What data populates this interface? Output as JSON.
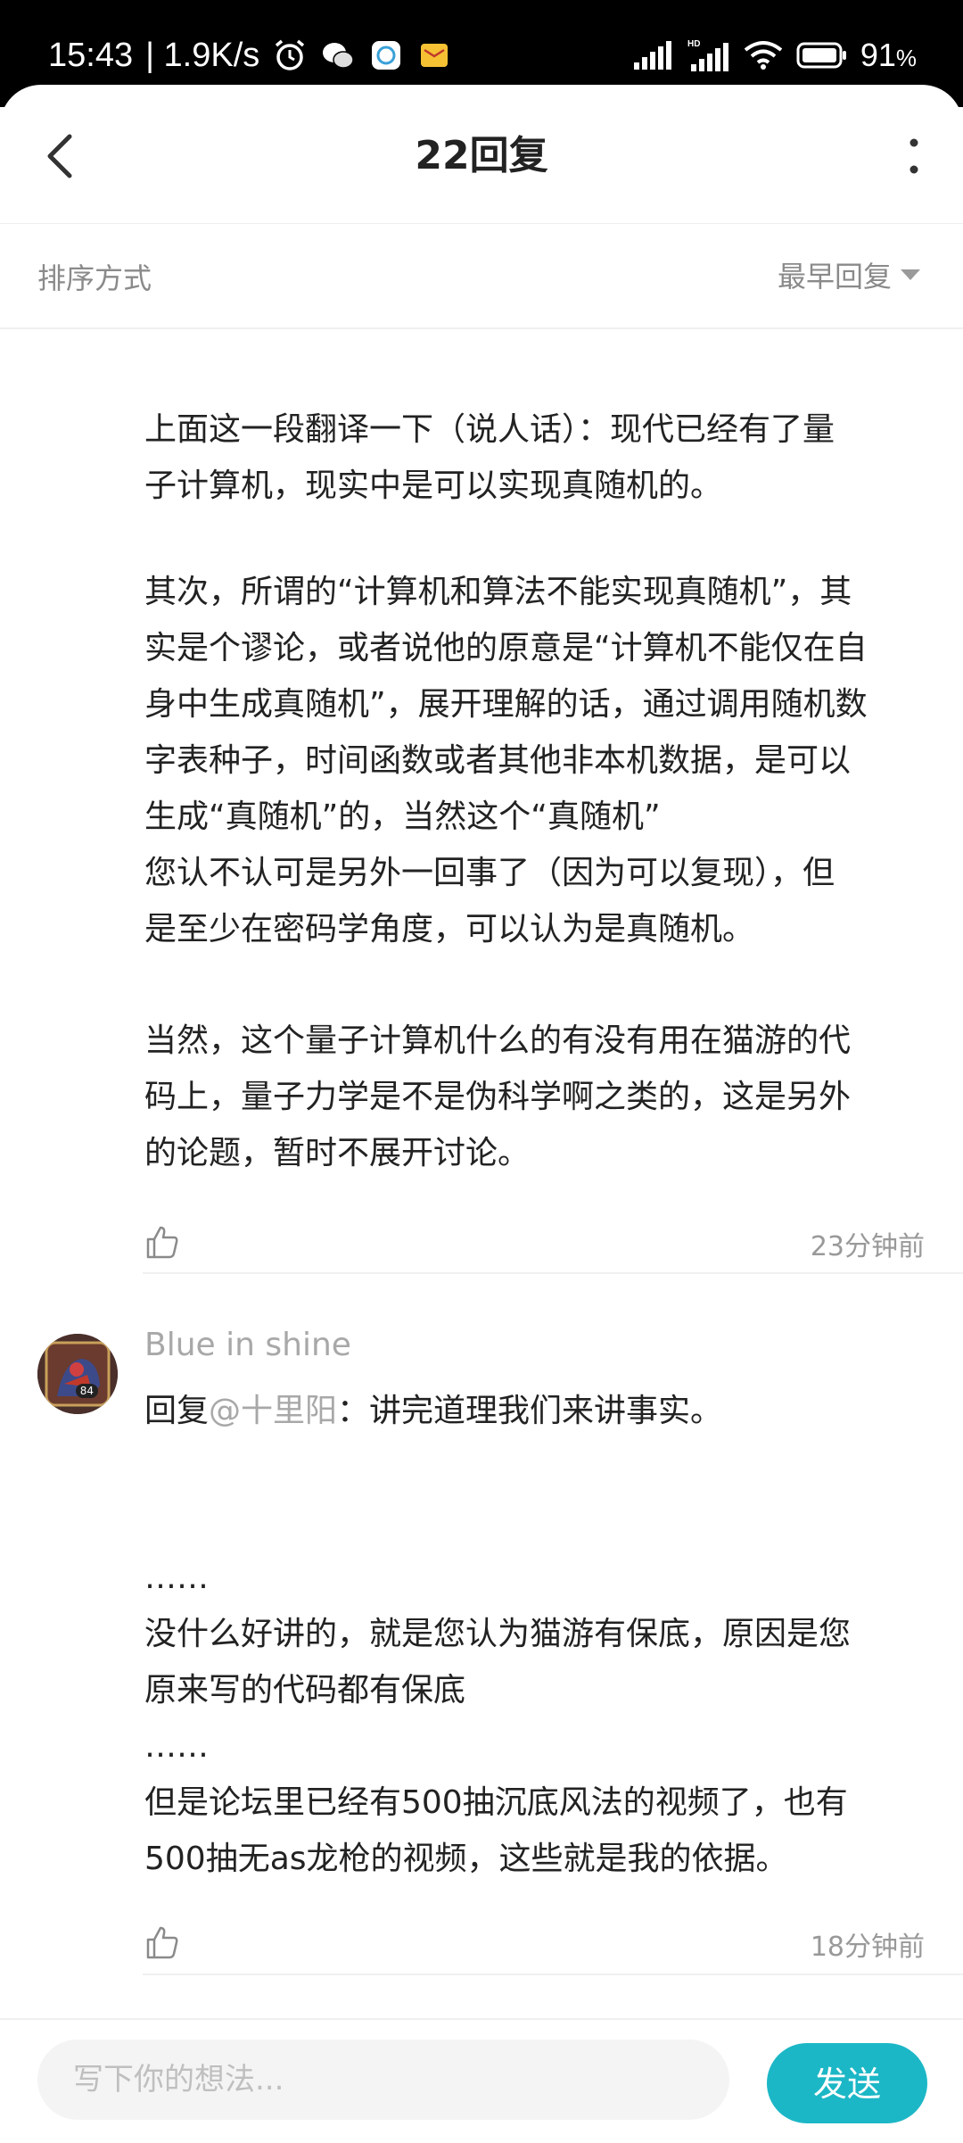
{
  "status_bar": {
    "time": "15:43",
    "network_speed": "| 1.9K/s",
    "battery": "91",
    "battery_unit": "%",
    "icons": [
      "alarm-icon",
      "wechat-icon",
      "app-notification-icon",
      "mail-icon",
      "signal-icon",
      "hd-signal-icon",
      "wifi-icon",
      "battery-icon"
    ]
  },
  "header": {
    "title": "22回复",
    "back_icon": "chevron-left-icon",
    "more_icon": "more-vertical-icon"
  },
  "sort_bar": {
    "label": "排序方式",
    "selected": "最早回复",
    "dropdown_icon": "triangle-down-icon"
  },
  "replies": [
    {
      "paragraphs": [
        "上面这一段翻译一下（说人话）：现代已经有了量\n子计算机，现实中是可以实现真随机的。",
        "其次，所谓的“计算机和算法不能实现真随机”，其\n实是个谬论，或者说他的原意是“计算机不能仅在自\n身中生成真随机”，展开理解的话，通过调用随机数\n字表种子，时间函数或者其他非本机数据，是可以\n生成“真随机”的，当然这个“真随机”\n您认不认可是另外一回事了（因为可以复现），但\n是至少在密码学角度，可以认为是真随机。",
        "当然，这个量子计算机什么的有没有用在猫游的代\n码上，量子力学是不是伪科学啊之类的，这是另外\n的论题，暂时不展开讨论。"
      ],
      "time": "23分钟前"
    },
    {
      "username": "Blue in shine",
      "avatar_level": "84",
      "reply_prefix": "回复",
      "mention": "@十里阳",
      "reply_text": "：讲完道理我们来讲事实。",
      "paragraphs": [
        "……\n没什么好讲的，就是您认为猫游有保底，原因是您\n原来写的代码都有保底\n……\n但是论坛里已经有500抽沉底风法的视频了，也有\n500抽无as龙枪的视频，这些就是我的依据。"
      ],
      "time": "18分钟前"
    }
  ],
  "bottom_bar": {
    "input_placeholder": "写下你的想法...",
    "send_label": "发送"
  },
  "colors": {
    "accent": "#1cb7c6",
    "muted_text": "#999999",
    "status_bar": "#000000"
  }
}
